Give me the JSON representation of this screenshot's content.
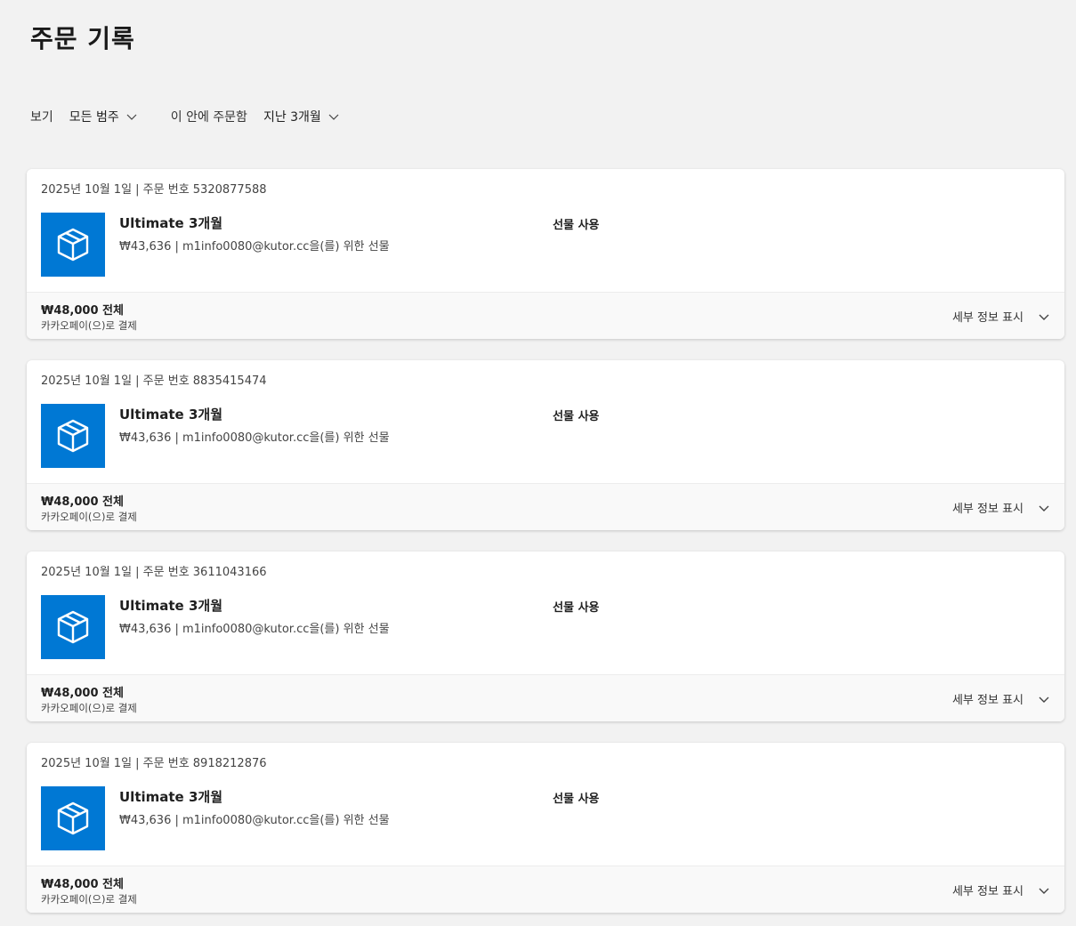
{
  "page": {
    "title": "주문 기록"
  },
  "filters": {
    "view_label": "보기",
    "category_value": "모든 범주",
    "ordered_within_label": "이 안에 주문함",
    "period_value": "지난 3개월"
  },
  "colors": {
    "product_tile": "#0078d4",
    "background": "#f2f2f2"
  },
  "orders": [
    {
      "header": "2025년 10월 1일 | 주문 번호 5320877588",
      "product_name": "Ultimate 3개월",
      "product_sub": "₩43,636 | m1info0080@kutor.cc을(를) 위한 선물",
      "gift_action": "선물 사용",
      "total": "₩48,000 전체",
      "payment": "카카오페이(으)로 결제",
      "details_label": "세부 정보 표시",
      "icon": "package-box-icon"
    },
    {
      "header": "2025년 10월 1일 | 주문 번호 8835415474",
      "product_name": "Ultimate 3개월",
      "product_sub": "₩43,636 | m1info0080@kutor.cc을(를) 위한 선물",
      "gift_action": "선물 사용",
      "total": "₩48,000 전체",
      "payment": "카카오페이(으)로 결제",
      "details_label": "세부 정보 표시",
      "icon": "package-box-icon"
    },
    {
      "header": "2025년 10월 1일 | 주문 번호 3611043166",
      "product_name": "Ultimate 3개월",
      "product_sub": "₩43,636 | m1info0080@kutor.cc을(를) 위한 선물",
      "gift_action": "선물 사용",
      "total": "₩48,000 전체",
      "payment": "카카오페이(으)로 결제",
      "details_label": "세부 정보 표시",
      "icon": "package-box-icon"
    },
    {
      "header": "2025년 10월 1일 | 주문 번호 8918212876",
      "product_name": "Ultimate 3개월",
      "product_sub": "₩43,636 | m1info0080@kutor.cc을(를) 위한 선물",
      "gift_action": "선물 사용",
      "total": "₩48,000 전체",
      "payment": "카카오페이(으)로 결제",
      "details_label": "세부 정보 표시",
      "icon": "package-box-icon"
    }
  ]
}
